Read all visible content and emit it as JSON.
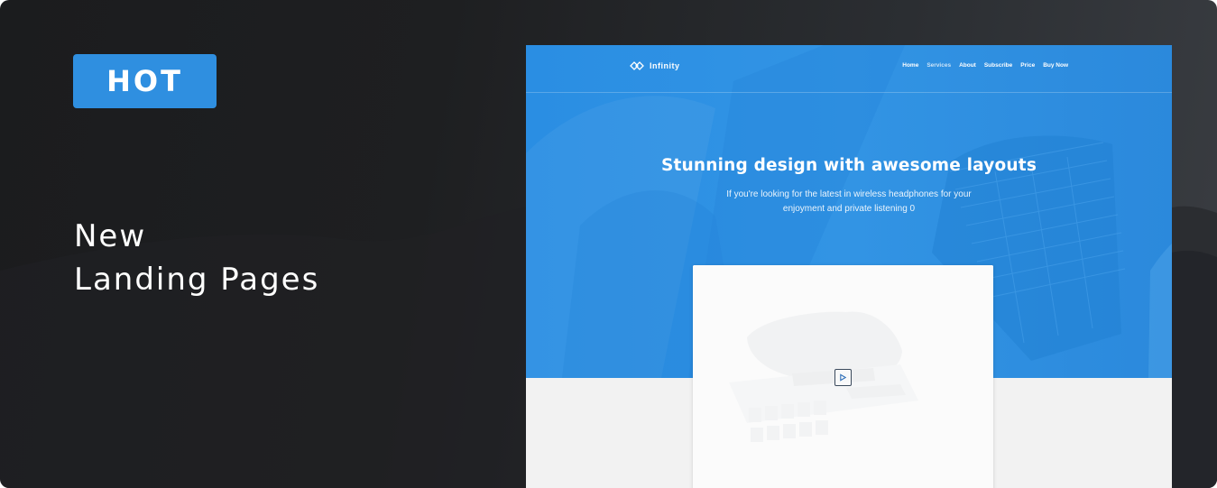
{
  "badge": {
    "label": "HOT"
  },
  "headline": {
    "line1": "New",
    "line2": "Landing Pages"
  },
  "preview": {
    "logo": {
      "text": "Infinity",
      "icon": "infinity-logo-icon"
    },
    "nav": [
      {
        "label": "Home"
      },
      {
        "label": "Services"
      },
      {
        "label": "About"
      },
      {
        "label": "Subscribe"
      },
      {
        "label": "Price"
      },
      {
        "label": "Buy Now"
      }
    ],
    "hero": {
      "title": "Stunning design with awesome layouts",
      "subtitle_line1": "If you're looking for the latest in wireless headphones for your",
      "subtitle_line2": "enjoyment and private listening 0"
    },
    "video": {
      "icon": "play-icon"
    }
  },
  "colors": {
    "accent": "#2f8fe0",
    "hero_blue": "#3294e4",
    "banner_dark": "#1e1f21",
    "section_gray": "#f2f2f2"
  }
}
